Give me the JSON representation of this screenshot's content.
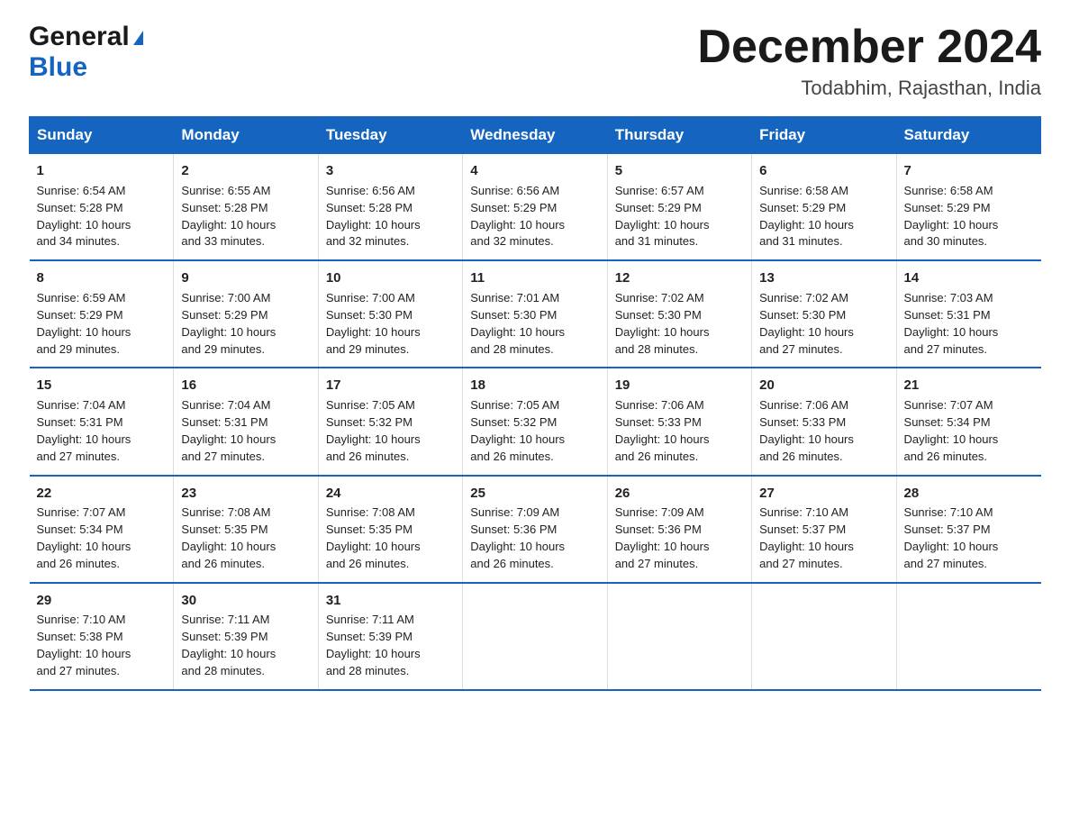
{
  "header": {
    "logo_general": "General",
    "logo_triangle": "▲",
    "logo_blue": "Blue",
    "title": "December 2024",
    "subtitle": "Todabhim, Rajasthan, India"
  },
  "columns": [
    "Sunday",
    "Monday",
    "Tuesday",
    "Wednesday",
    "Thursday",
    "Friday",
    "Saturday"
  ],
  "weeks": [
    [
      {
        "day": "1",
        "sunrise": "6:54 AM",
        "sunset": "5:28 PM",
        "daylight": "10 hours and 34 minutes."
      },
      {
        "day": "2",
        "sunrise": "6:55 AM",
        "sunset": "5:28 PM",
        "daylight": "10 hours and 33 minutes."
      },
      {
        "day": "3",
        "sunrise": "6:56 AM",
        "sunset": "5:28 PM",
        "daylight": "10 hours and 32 minutes."
      },
      {
        "day": "4",
        "sunrise": "6:56 AM",
        "sunset": "5:29 PM",
        "daylight": "10 hours and 32 minutes."
      },
      {
        "day": "5",
        "sunrise": "6:57 AM",
        "sunset": "5:29 PM",
        "daylight": "10 hours and 31 minutes."
      },
      {
        "day": "6",
        "sunrise": "6:58 AM",
        "sunset": "5:29 PM",
        "daylight": "10 hours and 31 minutes."
      },
      {
        "day": "7",
        "sunrise": "6:58 AM",
        "sunset": "5:29 PM",
        "daylight": "10 hours and 30 minutes."
      }
    ],
    [
      {
        "day": "8",
        "sunrise": "6:59 AM",
        "sunset": "5:29 PM",
        "daylight": "10 hours and 29 minutes."
      },
      {
        "day": "9",
        "sunrise": "7:00 AM",
        "sunset": "5:29 PM",
        "daylight": "10 hours and 29 minutes."
      },
      {
        "day": "10",
        "sunrise": "7:00 AM",
        "sunset": "5:30 PM",
        "daylight": "10 hours and 29 minutes."
      },
      {
        "day": "11",
        "sunrise": "7:01 AM",
        "sunset": "5:30 PM",
        "daylight": "10 hours and 28 minutes."
      },
      {
        "day": "12",
        "sunrise": "7:02 AM",
        "sunset": "5:30 PM",
        "daylight": "10 hours and 28 minutes."
      },
      {
        "day": "13",
        "sunrise": "7:02 AM",
        "sunset": "5:30 PM",
        "daylight": "10 hours and 27 minutes."
      },
      {
        "day": "14",
        "sunrise": "7:03 AM",
        "sunset": "5:31 PM",
        "daylight": "10 hours and 27 minutes."
      }
    ],
    [
      {
        "day": "15",
        "sunrise": "7:04 AM",
        "sunset": "5:31 PM",
        "daylight": "10 hours and 27 minutes."
      },
      {
        "day": "16",
        "sunrise": "7:04 AM",
        "sunset": "5:31 PM",
        "daylight": "10 hours and 27 minutes."
      },
      {
        "day": "17",
        "sunrise": "7:05 AM",
        "sunset": "5:32 PM",
        "daylight": "10 hours and 26 minutes."
      },
      {
        "day": "18",
        "sunrise": "7:05 AM",
        "sunset": "5:32 PM",
        "daylight": "10 hours and 26 minutes."
      },
      {
        "day": "19",
        "sunrise": "7:06 AM",
        "sunset": "5:33 PM",
        "daylight": "10 hours and 26 minutes."
      },
      {
        "day": "20",
        "sunrise": "7:06 AM",
        "sunset": "5:33 PM",
        "daylight": "10 hours and 26 minutes."
      },
      {
        "day": "21",
        "sunrise": "7:07 AM",
        "sunset": "5:34 PM",
        "daylight": "10 hours and 26 minutes."
      }
    ],
    [
      {
        "day": "22",
        "sunrise": "7:07 AM",
        "sunset": "5:34 PM",
        "daylight": "10 hours and 26 minutes."
      },
      {
        "day": "23",
        "sunrise": "7:08 AM",
        "sunset": "5:35 PM",
        "daylight": "10 hours and 26 minutes."
      },
      {
        "day": "24",
        "sunrise": "7:08 AM",
        "sunset": "5:35 PM",
        "daylight": "10 hours and 26 minutes."
      },
      {
        "day": "25",
        "sunrise": "7:09 AM",
        "sunset": "5:36 PM",
        "daylight": "10 hours and 26 minutes."
      },
      {
        "day": "26",
        "sunrise": "7:09 AM",
        "sunset": "5:36 PM",
        "daylight": "10 hours and 27 minutes."
      },
      {
        "day": "27",
        "sunrise": "7:10 AM",
        "sunset": "5:37 PM",
        "daylight": "10 hours and 27 minutes."
      },
      {
        "day": "28",
        "sunrise": "7:10 AM",
        "sunset": "5:37 PM",
        "daylight": "10 hours and 27 minutes."
      }
    ],
    [
      {
        "day": "29",
        "sunrise": "7:10 AM",
        "sunset": "5:38 PM",
        "daylight": "10 hours and 27 minutes."
      },
      {
        "day": "30",
        "sunrise": "7:11 AM",
        "sunset": "5:39 PM",
        "daylight": "10 hours and 28 minutes."
      },
      {
        "day": "31",
        "sunrise": "7:11 AM",
        "sunset": "5:39 PM",
        "daylight": "10 hours and 28 minutes."
      },
      null,
      null,
      null,
      null
    ]
  ],
  "labels": {
    "sunrise": "Sunrise:",
    "sunset": "Sunset:",
    "daylight": "Daylight:"
  }
}
